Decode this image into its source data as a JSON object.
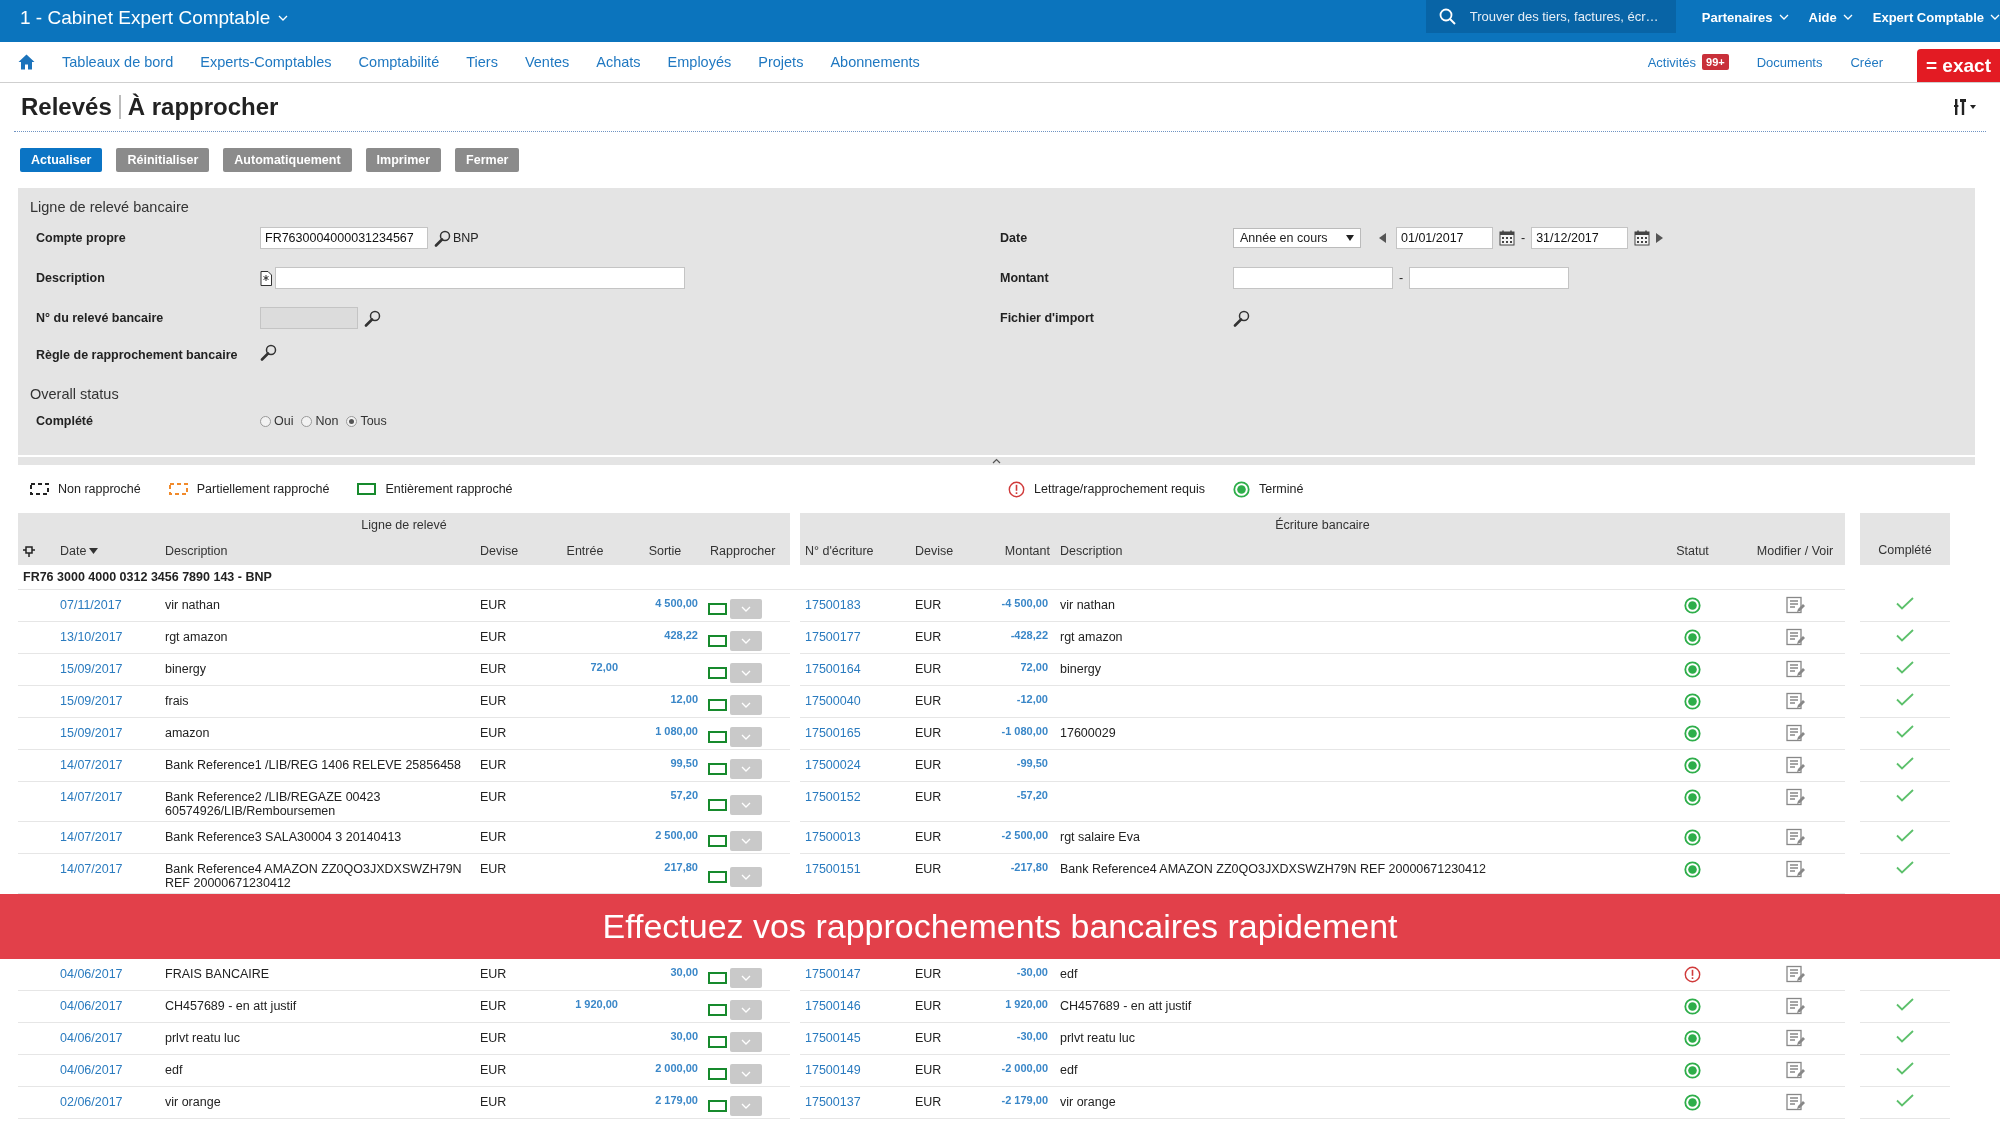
{
  "top_bar": {
    "company": "1 - Cabinet Expert Comptable",
    "search": {
      "placeholder": "Trouver des tiers, factures, écr…"
    },
    "menus": [
      "Partenaires",
      "Aide",
      "Expert Comptable"
    ]
  },
  "nav": {
    "items": [
      "Tableaux de bord",
      "Experts-Comptables",
      "Comptabilité",
      "Tiers",
      "Ventes",
      "Achats",
      "Employés",
      "Projets",
      "Abonnements"
    ],
    "right": [
      {
        "label": "Activités",
        "badge": "99+"
      },
      {
        "label": "Documents"
      },
      {
        "label": "Créer"
      }
    ],
    "logo": "= exact"
  },
  "page": {
    "title": "Relevés",
    "subtitle": "À rapprocher"
  },
  "buttons": [
    {
      "label": "Actualiser",
      "kind": "primary"
    },
    {
      "label": "Réinitialiser",
      "kind": "default"
    },
    {
      "label": "Automatiquement",
      "kind": "default"
    },
    {
      "label": "Imprimer",
      "kind": "default"
    },
    {
      "label": "Fermer",
      "kind": "default"
    }
  ],
  "filters": {
    "section_title": "Ligne de relevé bancaire",
    "own_account": {
      "label": "Compte propre",
      "value": "FR7630004000031234567",
      "bank": "BNP"
    },
    "description": {
      "label": "Description"
    },
    "statement_number": {
      "label": "N° du relevé bancaire",
      "disabled": true
    },
    "rule": {
      "label": "Règle de rapprochement bancaire"
    },
    "date": {
      "label": "Date",
      "period": "Année en cours",
      "from": "01/01/2017",
      "separator": "-",
      "to": "31/12/2017"
    },
    "amount": {
      "label": "Montant",
      "separator": "-"
    },
    "import_file": {
      "label": "Fichier d'import"
    },
    "status_title": "Overall status",
    "complete": {
      "label": "Complété",
      "options": [
        {
          "label": "Oui",
          "selected": false
        },
        {
          "label": "Non",
          "selected": false
        },
        {
          "label": "Tous",
          "selected": true
        }
      ]
    }
  },
  "legend": [
    {
      "label": "Non rapproché",
      "kind": "none"
    },
    {
      "label": "Partiellement rapproché",
      "kind": "partial"
    },
    {
      "label": "Entièrement rapproché",
      "kind": "full"
    },
    {
      "label": "Lettrage/rapprochement requis",
      "kind": "required"
    },
    {
      "label": "Terminé",
      "kind": "done"
    }
  ],
  "table": {
    "left_group": "Ligne de relevé",
    "right_group": "Écriture bancaire",
    "columns_left": [
      {
        "label": "Date",
        "sorted": true
      },
      {
        "label": "Description",
        "sorted": false
      },
      {
        "label": "Devise",
        "sorted": false
      },
      {
        "label": "Entrée",
        "sorted": false
      },
      {
        "label": "Sortie",
        "sorted": false
      },
      {
        "label": "Rapprocher",
        "sorted": false
      }
    ],
    "columns_right": [
      "N° d'écriture",
      "Devise",
      "Montant",
      "Description",
      "Statut",
      "Modifier / Voir"
    ],
    "completed_column": "Complété",
    "account_group": "FR76 3000 4000 0312 3456 7890 143 - BNP",
    "rows": [
      {
        "kind": "entry",
        "date": "07/11/2017",
        "description": "vir nathan",
        "currency": "EUR",
        "out": "4 500,00",
        "match": {
          "kind": "full"
        },
        "entry_number": "17500183",
        "entry_currency": "EUR",
        "amount": "-4 500,00",
        "entry_description": "vir nathan",
        "status": {
          "kind": "done"
        },
        "completed": true
      },
      {
        "kind": "entry",
        "date": "13/10/2017",
        "description": "rgt amazon",
        "currency": "EUR",
        "out": "428,22",
        "match": {
          "kind": "full"
        },
        "entry_number": "17500177",
        "entry_currency": "EUR",
        "amount": "-428,22",
        "entry_description": "rgt amazon",
        "status": {
          "kind": "done"
        },
        "completed": true
      },
      {
        "kind": "entry",
        "date": "15/09/2017",
        "description": "binergy",
        "currency": "EUR",
        "in": "72,00",
        "match": {
          "kind": "full"
        },
        "entry_number": "17500164",
        "entry_currency": "EUR",
        "amount": "72,00",
        "entry_description": "binergy",
        "status": {
          "kind": "done"
        },
        "completed": true
      },
      {
        "kind": "entry",
        "date": "15/09/2017",
        "description": "frais",
        "currency": "EUR",
        "out": "12,00",
        "match": {
          "kind": "full"
        },
        "entry_number": "17500040",
        "entry_currency": "EUR",
        "amount": "-12,00",
        "status": {
          "kind": "done"
        },
        "completed": true
      },
      {
        "kind": "entry",
        "date": "15/09/2017",
        "description": "amazon",
        "currency": "EUR",
        "out": "1 080,00",
        "match": {
          "kind": "full"
        },
        "entry_number": "17500165",
        "entry_currency": "EUR",
        "amount": "-1 080,00",
        "entry_description": "17600029",
        "status": {
          "kind": "done"
        },
        "completed": true
      },
      {
        "kind": "entry",
        "date": "14/07/2017",
        "description": "Bank Reference1 /LIB/REG 1406 RELEVE 25856458",
        "currency": "EUR",
        "out": "99,50",
        "match": {
          "kind": "full"
        },
        "entry_number": "17500024",
        "entry_currency": "EUR",
        "amount": "-99,50",
        "status": {
          "kind": "done"
        },
        "completed": true
      },
      {
        "kind": "entry",
        "date": "14/07/2017",
        "description": "Bank Reference2 /LIB/REGAZE 00423 60574926/LIB/Remboursemen",
        "currency": "EUR",
        "out": "57,20",
        "match": {
          "kind": "full"
        },
        "entry_number": "17500152",
        "entry_currency": "EUR",
        "amount": "-57,20",
        "status": {
          "kind": "done"
        },
        "completed": true
      },
      {
        "kind": "entry",
        "date": "14/07/2017",
        "description": "Bank Reference3 SALA30004 3 20140413",
        "currency": "EUR",
        "out": "2 500,00",
        "match": {
          "kind": "full"
        },
        "entry_number": "17500013",
        "entry_currency": "EUR",
        "amount": "-2 500,00",
        "entry_description": "rgt salaire Eva",
        "status": {
          "kind": "done"
        },
        "completed": true
      },
      {
        "kind": "entry",
        "date": "14/07/2017",
        "description": "Bank Reference4 AMAZON ZZ0QO3JXDXSWZH79N REF 20000671230412",
        "currency": "EUR",
        "out": "217,80",
        "match": {
          "kind": "full"
        },
        "entry_number": "17500151",
        "entry_currency": "EUR",
        "amount": "-217,80",
        "entry_description": "Bank Reference4 AMAZON ZZ0QO3JXDXSWZH79N REF 20000671230412",
        "status": {
          "kind": "done"
        },
        "completed": true
      },
      {
        "kind": "caption",
        "text": "Effectuez vos rapprochements bancaires rapidement"
      },
      {
        "kind": "entry",
        "date": "04/06/2017",
        "description": "FRAIS BANCAIRE",
        "currency": "EUR",
        "out": "30,00",
        "match": {
          "kind": "full"
        },
        "entry_number": "17500147",
        "entry_currency": "EUR",
        "amount": "-30,00",
        "entry_description": "edf",
        "status": {
          "kind": "required"
        },
        "completed": false
      },
      {
        "kind": "entry",
        "date": "04/06/2017",
        "description": "CH457689 - en att justif",
        "currency": "EUR",
        "in": "1 920,00",
        "match": {
          "kind": "full"
        },
        "entry_number": "17500146",
        "entry_currency": "EUR",
        "amount": "1 920,00",
        "entry_description": "CH457689 - en att justif",
        "status": {
          "kind": "done"
        },
        "completed": true
      },
      {
        "kind": "entry",
        "date": "04/06/2017",
        "description": "prlvt reatu luc",
        "currency": "EUR",
        "out": "30,00",
        "match": {
          "kind": "full"
        },
        "entry_number": "17500145",
        "entry_currency": "EUR",
        "amount": "-30,00",
        "entry_description": "prlvt reatu luc",
        "status": {
          "kind": "done"
        },
        "completed": true
      },
      {
        "kind": "entry",
        "date": "04/06/2017",
        "description": "edf",
        "currency": "EUR",
        "out": "2 000,00",
        "match": {
          "kind": "full"
        },
        "entry_number": "17500149",
        "entry_currency": "EUR",
        "amount": "-2 000,00",
        "entry_description": "edf",
        "status": {
          "kind": "done"
        },
        "completed": true
      },
      {
        "kind": "entry",
        "date": "02/06/2017",
        "description": "vir orange",
        "currency": "EUR",
        "out": "2 179,00",
        "match": {
          "kind": "full"
        },
        "entry_number": "17500137",
        "entry_currency": "EUR",
        "amount": "-2 179,00",
        "entry_description": "vir orange",
        "status": {
          "kind": "done"
        },
        "completed": true
      }
    ]
  }
}
